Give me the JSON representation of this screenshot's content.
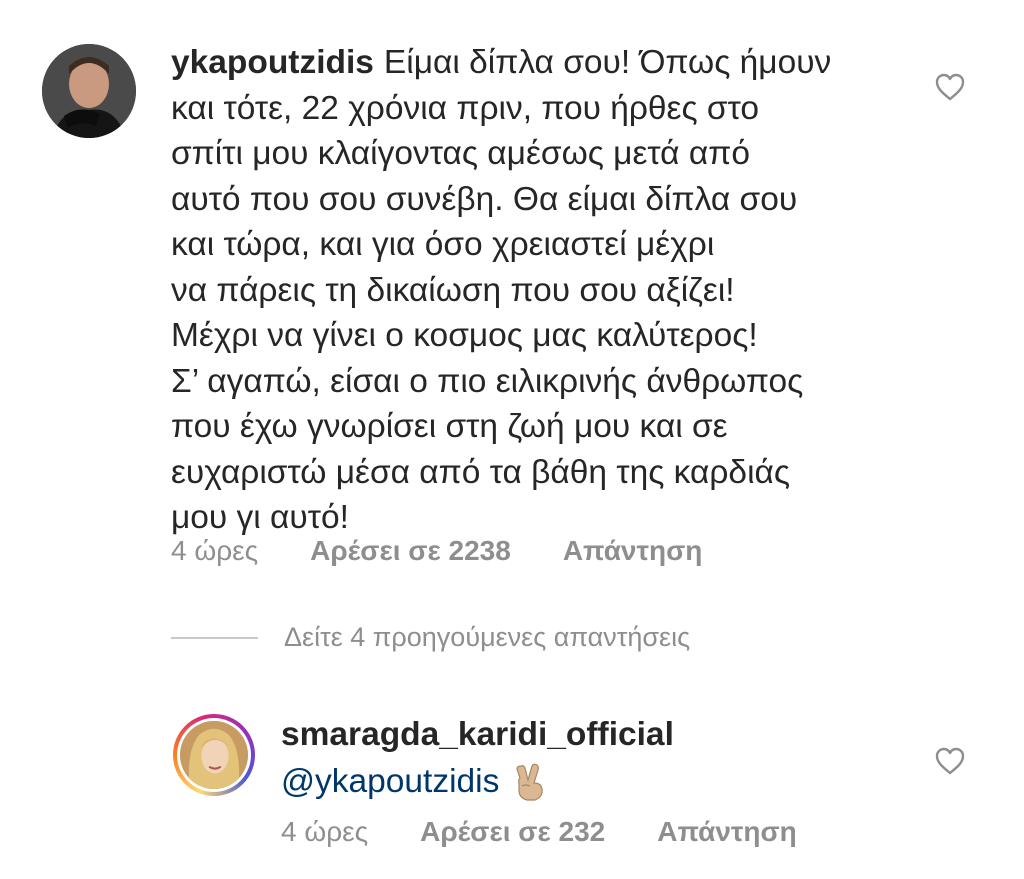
{
  "comment": {
    "username": "ykapoutzidis",
    "lines": [
      "Είμαι δίπλα σου! Όπως ήμουν",
      "και τότε, 22 χρόνια πριν, που ήρθες στο",
      "σπίτι μου κλαίγοντας αμέσως μετά από",
      "αυτό που σου συνέβη. Θα είμαι δίπλα σου",
      "και τώρα, και για όσο χρειαστεί μέχρι",
      "να πάρεις τη δικαίωση που σου αξίζει!",
      "Μέχρι να γίνει ο κοσμος μας καλύτερος!",
      "Σ’ αγαπώ, είσαι ο πιο ειλικρινής άνθρωπος",
      "που έχω γνωρίσει στη ζωή μου και σε",
      "ευχαριστώ μέσα από τα βάθη της καρδιάς",
      "μου γι αυτό!"
    ],
    "time": "4 ώρες",
    "likes": "Αρέσει σε 2238",
    "reply": "Απάντηση",
    "avatar_icon": "user-avatar-photo",
    "like_icon": "heart-outline-icon"
  },
  "view_replies": "Δείτε 4 προηγούμενες απαντήσεις",
  "reply_comment": {
    "username": "smaragda_karidi_official",
    "mention": "@ykapoutzidis",
    "emoji": "victory-hand-emoji",
    "time": "4 ώρες",
    "likes": "Αρέσει σε 232",
    "reply": "Απάντηση",
    "avatar_icon": "user-avatar-photo-story-ring",
    "like_icon": "heart-outline-icon"
  },
  "colors": {
    "text": "#262626",
    "secondary": "#8e8e8e",
    "mention": "#00376b",
    "divider": "#c7c7c7"
  }
}
